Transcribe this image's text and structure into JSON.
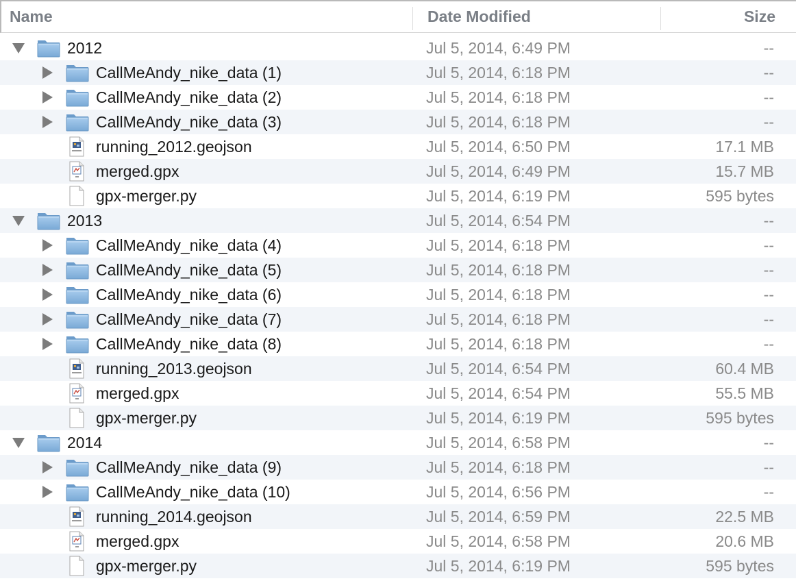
{
  "columns": {
    "name": "Name",
    "date_modified": "Date Modified",
    "size": "Size"
  },
  "rows": [
    {
      "name": "2012",
      "date": "Jul 5, 2014, 6:49 PM",
      "size": "--",
      "kind": "folder",
      "level": 0,
      "expanded": true
    },
    {
      "name": "CallMeAndy_nike_data (1)",
      "date": "Jul 5, 2014, 6:18 PM",
      "size": "--",
      "kind": "folder",
      "level": 1,
      "expanded": false
    },
    {
      "name": "CallMeAndy_nike_data (2)",
      "date": "Jul 5, 2014, 6:18 PM",
      "size": "--",
      "kind": "folder",
      "level": 1,
      "expanded": false
    },
    {
      "name": "CallMeAndy_nike_data (3)",
      "date": "Jul 5, 2014, 6:18 PM",
      "size": "--",
      "kind": "folder",
      "level": 1,
      "expanded": false
    },
    {
      "name": "running_2012.geojson",
      "date": "Jul 5, 2014, 6:50 PM",
      "size": "17.1 MB",
      "kind": "geojson",
      "level": 1
    },
    {
      "name": "merged.gpx",
      "date": "Jul 5, 2014, 6:49 PM",
      "size": "15.7 MB",
      "kind": "gpx",
      "level": 1
    },
    {
      "name": "gpx-merger.py",
      "date": "Jul 5, 2014, 6:19 PM",
      "size": "595 bytes",
      "kind": "text",
      "level": 1
    },
    {
      "name": "2013",
      "date": "Jul 5, 2014, 6:54 PM",
      "size": "--",
      "kind": "folder",
      "level": 0,
      "expanded": true
    },
    {
      "name": "CallMeAndy_nike_data (4)",
      "date": "Jul 5, 2014, 6:18 PM",
      "size": "--",
      "kind": "folder",
      "level": 1,
      "expanded": false
    },
    {
      "name": "CallMeAndy_nike_data (5)",
      "date": "Jul 5, 2014, 6:18 PM",
      "size": "--",
      "kind": "folder",
      "level": 1,
      "expanded": false
    },
    {
      "name": "CallMeAndy_nike_data (6)",
      "date": "Jul 5, 2014, 6:18 PM",
      "size": "--",
      "kind": "folder",
      "level": 1,
      "expanded": false
    },
    {
      "name": "CallMeAndy_nike_data (7)",
      "date": "Jul 5, 2014, 6:18 PM",
      "size": "--",
      "kind": "folder",
      "level": 1,
      "expanded": false
    },
    {
      "name": "CallMeAndy_nike_data (8)",
      "date": "Jul 5, 2014, 6:18 PM",
      "size": "--",
      "kind": "folder",
      "level": 1,
      "expanded": false
    },
    {
      "name": "running_2013.geojson",
      "date": "Jul 5, 2014, 6:54 PM",
      "size": "60.4 MB",
      "kind": "geojson",
      "level": 1
    },
    {
      "name": "merged.gpx",
      "date": "Jul 5, 2014, 6:54 PM",
      "size": "55.5 MB",
      "kind": "gpx",
      "level": 1
    },
    {
      "name": "gpx-merger.py",
      "date": "Jul 5, 2014, 6:19 PM",
      "size": "595 bytes",
      "kind": "text",
      "level": 1
    },
    {
      "name": "2014",
      "date": "Jul 5, 2014, 6:58 PM",
      "size": "--",
      "kind": "folder",
      "level": 0,
      "expanded": true
    },
    {
      "name": "CallMeAndy_nike_data (9)",
      "date": "Jul 5, 2014, 6:18 PM",
      "size": "--",
      "kind": "folder",
      "level": 1,
      "expanded": false
    },
    {
      "name": "CallMeAndy_nike_data (10)",
      "date": "Jul 5, 2014, 6:56 PM",
      "size": "--",
      "kind": "folder",
      "level": 1,
      "expanded": false
    },
    {
      "name": "running_2014.geojson",
      "date": "Jul 5, 2014, 6:59 PM",
      "size": "22.5 MB",
      "kind": "geojson",
      "level": 1
    },
    {
      "name": "merged.gpx",
      "date": "Jul 5, 2014, 6:58 PM",
      "size": "20.6 MB",
      "kind": "gpx",
      "level": 1
    },
    {
      "name": "gpx-merger.py",
      "date": "Jul 5, 2014, 6:19 PM",
      "size": "595 bytes",
      "kind": "text",
      "level": 1
    }
  ],
  "icons": {
    "folder": "folder-icon",
    "geojson": "geojson-file-icon",
    "gpx": "gpx-file-icon",
    "text": "text-file-icon",
    "expanded": "disclosure-triangle-down-icon",
    "collapsed": "disclosure-triangle-right-icon"
  },
  "colors": {
    "alt_row": "#f2f5f9",
    "header_text": "#7a7f86",
    "secondary_text": "#8a8a8a",
    "folder_blue": "#8fb8de"
  }
}
